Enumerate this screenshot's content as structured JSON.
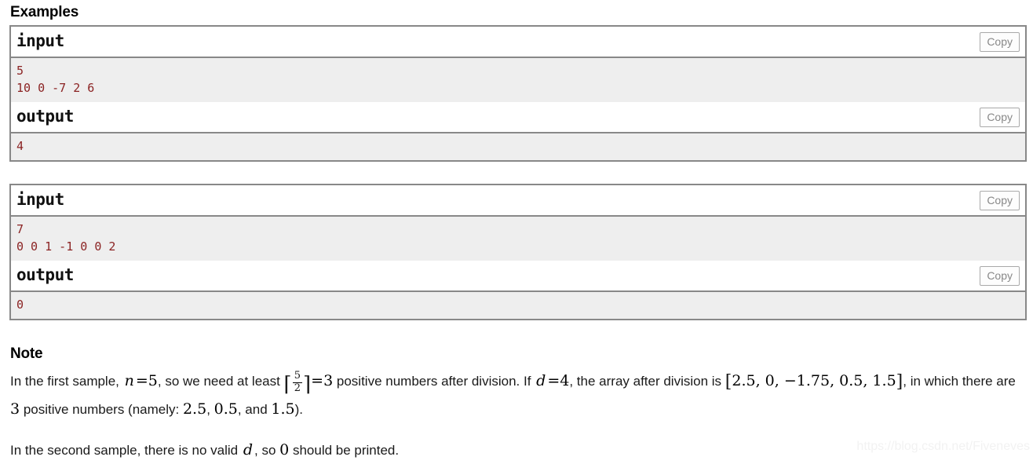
{
  "sections": {
    "examples_title": "Examples",
    "note_title": "Note"
  },
  "copy_label": "Copy",
  "samples": [
    {
      "input_label": "input",
      "input_data": "5\n10 0 -7 2 6",
      "output_label": "output",
      "output_data": "4"
    },
    {
      "input_label": "input",
      "input_data": "7\n0 0 1 -1 0 0 2",
      "output_label": "output",
      "output_data": "0"
    }
  ],
  "note": {
    "para1": {
      "t1": "In the first sample, ",
      "m1_var": "n",
      "m1_op": "=",
      "m1_val": "5",
      "t2": ", so we need at least ",
      "frac_num": "5",
      "frac_den": "2",
      "m2_op": "=",
      "m2_val": "3",
      "t3": " positive numbers after division. If ",
      "m3_var": "d",
      "m3_op": "=",
      "m3_val": "4",
      "t4": ", the array after division is ",
      "m4_array": "2.5, 0, −1.75, 0.5, 1.5",
      "t5": ", in which there are ",
      "m5_val": "3",
      "t6": " positive numbers (namely: ",
      "m6_val": "2.5",
      "t7": ", ",
      "m7_val": "0.5",
      "t8": ", and ",
      "m8_val": "1.5",
      "t9": ")."
    },
    "para2": {
      "t1": "In the second sample, there is no valid ",
      "m1_var": "d",
      "t2": ", so ",
      "m2_val": "0",
      "t3": " should be printed."
    }
  },
  "watermark": "https://blog.csdn.net/Fiveneves",
  "colors": {
    "border": "#888888",
    "data_bg": "#eeeeee",
    "data_text": "#8b2323",
    "copy_text": "#888888",
    "watermark": "#f2f2f2"
  }
}
